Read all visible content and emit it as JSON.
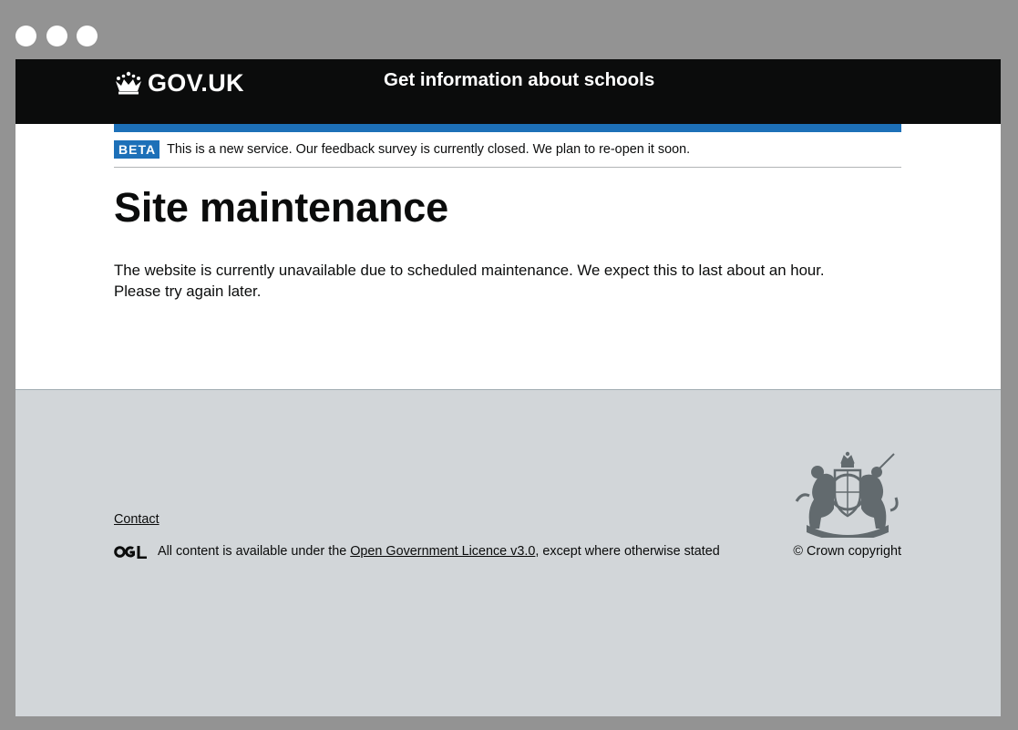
{
  "header": {
    "logo_text": "GOV.UK",
    "service_name": "Get information about schools"
  },
  "phase_banner": {
    "tag": "BETA",
    "text": "This is a new service. Our feedback survey is currently closed. We plan to re-open it soon."
  },
  "main": {
    "title": "Site maintenance",
    "line1": "The website is currently unavailable due to scheduled maintenance. We expect this to last about an hour.",
    "line2": "Please try again later."
  },
  "footer": {
    "contact": "Contact",
    "licence_prefix": "All content is available under the ",
    "licence_link": "Open Government Licence v3.0",
    "licence_suffix": ", except where otherwise stated",
    "copyright": "© Crown copyright"
  },
  "colors": {
    "header_bg": "#0b0c0c",
    "brand_blue": "#1d70b8",
    "footer_bg": "#d2d6d9",
    "frame_gray": "#939393"
  },
  "icons": [
    "crown-icon",
    "ogl-logo-icon",
    "royal-coat-of-arms-icon"
  ]
}
